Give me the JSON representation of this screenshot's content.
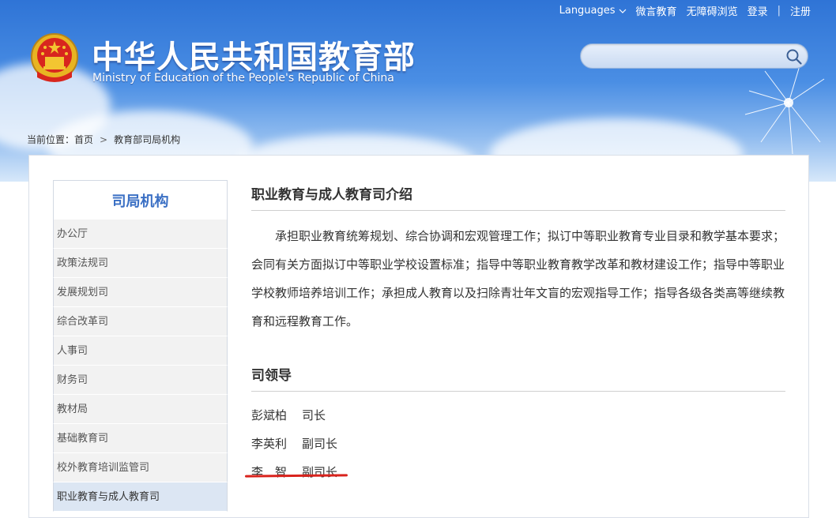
{
  "topnav": {
    "languages": "Languages",
    "weiyan": "微言教育",
    "accessible": "无障碍浏览",
    "login": "登录",
    "separator": "|",
    "register": "注册"
  },
  "header": {
    "title_cn": "中华人民共和国教育部",
    "title_en": "Ministry of Education of the People's Republic of China"
  },
  "search": {
    "placeholder": ""
  },
  "breadcrumb": {
    "prefix": "当前位置：",
    "home": "首页",
    "arrow": ">",
    "current": "教育部司局机构"
  },
  "sidebar": {
    "title": "司局机构",
    "items": [
      {
        "label": "办公厅"
      },
      {
        "label": "政策法规司"
      },
      {
        "label": "发展规划司"
      },
      {
        "label": "综合改革司"
      },
      {
        "label": "人事司"
      },
      {
        "label": "财务司"
      },
      {
        "label": "教材局"
      },
      {
        "label": "基础教育司"
      },
      {
        "label": "校外教育培训监管司"
      },
      {
        "label": "职业教育与成人教育司"
      }
    ]
  },
  "main": {
    "intro_title": "职业教育与成人教育司介绍",
    "intro_text": "承担职业教育统筹规划、综合协调和宏观管理工作；拟订中等职业教育专业目录和教学基本要求；会同有关方面拟订中等职业学校设置标准；指导中等职业教育教学改革和教材建设工作；指导中等职业学校教师培养培训工作；承担成人教育以及扫除青壮年文盲的宏观指导工作；指导各级各类高等继续教育和远程教育工作。",
    "leaders_title": "司领导",
    "leaders": [
      {
        "name": "彭斌柏",
        "role": "司长"
      },
      {
        "name": "李英利",
        "role": "副司长"
      },
      {
        "name": "李　智",
        "role": "副司长"
      }
    ]
  }
}
